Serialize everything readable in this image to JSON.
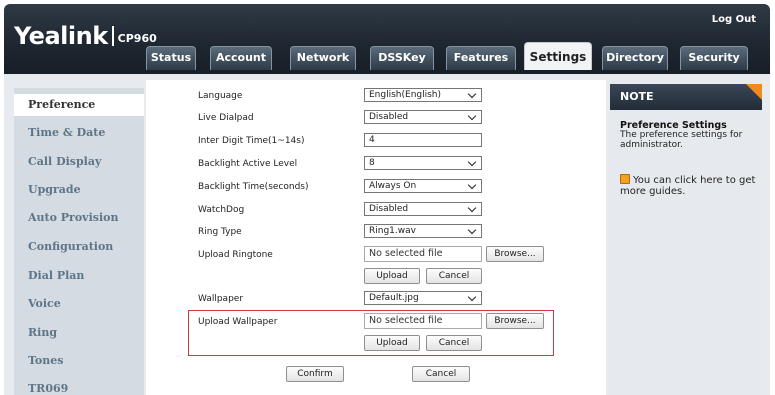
{
  "header": {
    "brand": "Yealink",
    "model": "CP960",
    "logout": "Log Out"
  },
  "tabs": [
    {
      "label": "Status"
    },
    {
      "label": "Account"
    },
    {
      "label": "Network"
    },
    {
      "label": "DSSKey"
    },
    {
      "label": "Features"
    },
    {
      "label": "Settings",
      "active": true
    },
    {
      "label": "Directory"
    },
    {
      "label": "Security"
    }
  ],
  "sidebar": {
    "items": [
      {
        "label": "Preference",
        "active": true
      },
      {
        "label": "Time & Date"
      },
      {
        "label": "Call Display"
      },
      {
        "label": "Upgrade"
      },
      {
        "label": "Auto Provision"
      },
      {
        "label": "Configuration"
      },
      {
        "label": "Dial Plan"
      },
      {
        "label": "Voice"
      },
      {
        "label": "Ring"
      },
      {
        "label": "Tones"
      },
      {
        "label": "TR069"
      }
    ]
  },
  "form": {
    "language": {
      "label": "Language",
      "value": "English(English)"
    },
    "live_dialpad": {
      "label": "Live Dialpad",
      "value": "Disabled"
    },
    "inter_digit": {
      "label": "Inter Digit Time(1~14s)",
      "value": "4"
    },
    "backlight_level": {
      "label": "Backlight Active Level",
      "value": "8"
    },
    "backlight_time": {
      "label": "Backlight Time(seconds)",
      "value": "Always On"
    },
    "watchdog": {
      "label": "WatchDog",
      "value": "Disabled"
    },
    "ring_type": {
      "label": "Ring Type",
      "value": "Ring1.wav"
    },
    "upload_ringtone": {
      "label": "Upload Ringtone",
      "file": "No selected file",
      "browse": "Browse...",
      "upload": "Upload",
      "cancel": "Cancel"
    },
    "wallpaper": {
      "label": "Wallpaper",
      "value": "Default.jpg"
    },
    "upload_wallpaper": {
      "label": "Upload Wallpaper",
      "file": "No selected file",
      "browse": "Browse...",
      "upload": "Upload",
      "cancel": "Cancel"
    },
    "confirm": "Confirm",
    "cancel": "Cancel"
  },
  "note": {
    "heading": "NOTE",
    "title": "Preference Settings",
    "text": "The preference settings for administrator.",
    "guide": "You can click here to get more guides."
  }
}
